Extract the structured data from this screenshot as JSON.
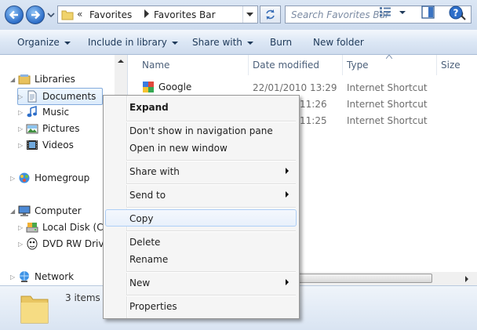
{
  "address": {
    "history_glyph": "«",
    "crumbs": [
      "Favorites",
      "Favorites Bar"
    ],
    "separator": "▶"
  },
  "search": {
    "placeholder": "Search Favorites Bar"
  },
  "toolbar": {
    "organize": "Organize",
    "include_in_library": "Include in library",
    "share_with": "Share with",
    "burn": "Burn",
    "new_folder": "New folder"
  },
  "nav": {
    "libraries": "Libraries",
    "documents": "Documents",
    "music": "Music",
    "pictures": "Pictures",
    "videos": "Videos",
    "homegroup": "Homegroup",
    "computer": "Computer",
    "local_disk": "Local Disk (C:)",
    "dvd": "DVD RW Drive",
    "network": "Network"
  },
  "columns": {
    "name": "Name",
    "date": "Date modified",
    "type": "Type",
    "size": "Size"
  },
  "files": [
    {
      "name": "Google",
      "date": "22/01/2010 13:29",
      "type": "Internet Shortcut"
    },
    {
      "name": "",
      "date": "11:26",
      "type": "Internet Shortcut"
    },
    {
      "name": "",
      "date": "11:25",
      "type": "Internet Shortcut"
    }
  ],
  "details": {
    "count": "3 items"
  },
  "context_menu": {
    "expand": "Expand",
    "dont_show": "Don't show in navigation pane",
    "open_new_window": "Open in new window",
    "share_with": "Share with",
    "send_to": "Send to",
    "copy": "Copy",
    "delete": "Delete",
    "rename": "Rename",
    "new": "New",
    "properties": "Properties"
  },
  "colors": {
    "accent": "#2d6ec9",
    "toolbar_text": "#1e3959",
    "selection_border": "#84acdd"
  }
}
